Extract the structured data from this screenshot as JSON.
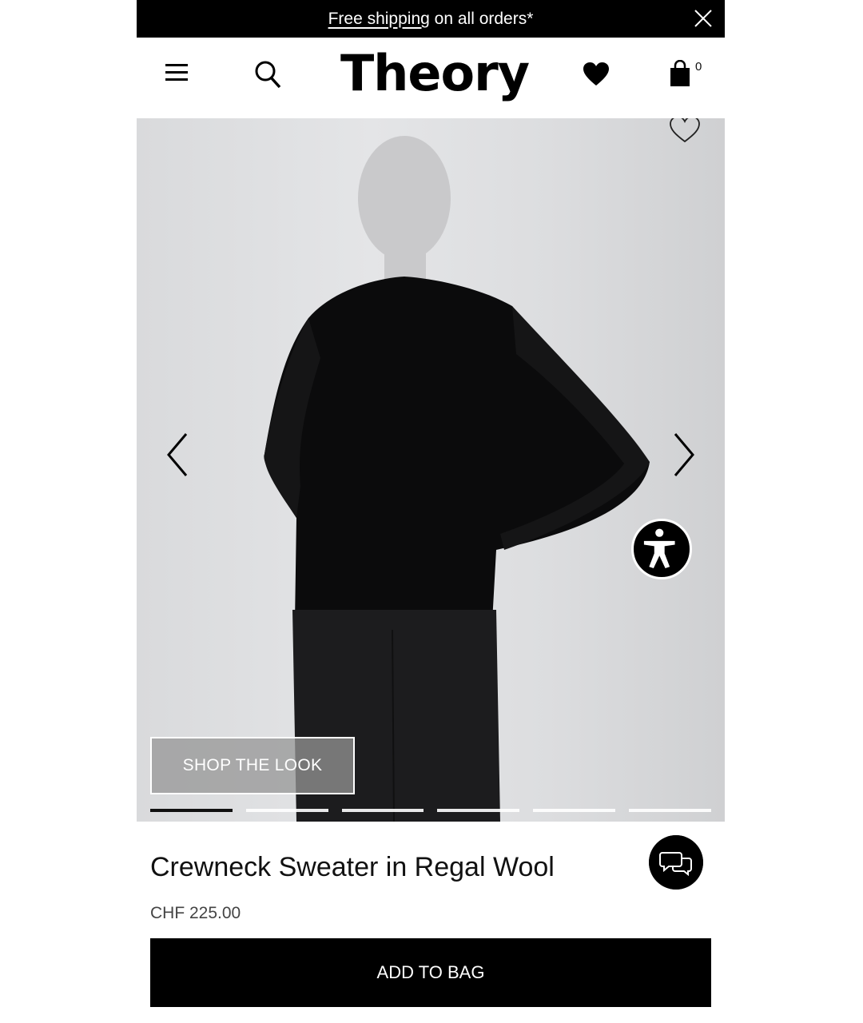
{
  "promo": {
    "link_text": "Free shipping",
    "rest_text": " on all orders*"
  },
  "header": {
    "logo": "Theory",
    "bag_count": "0"
  },
  "hero": {
    "shop_the_look": "SHOP THE LOOK",
    "slide_count": 6,
    "active_slide": 1
  },
  "product": {
    "name": "Crewneck Sweater in Regal Wool",
    "price": "CHF 225.00",
    "add_to_bag": "ADD TO BAG"
  },
  "icons": [
    "menu-icon",
    "search-icon",
    "heart-icon",
    "bag-icon",
    "close-icon",
    "heart-outline-icon",
    "chevron-left-icon",
    "chevron-right-icon",
    "accessibility-icon",
    "chat-icon"
  ],
  "colors": {
    "accent": "#000000",
    "background": "#ffffff"
  }
}
